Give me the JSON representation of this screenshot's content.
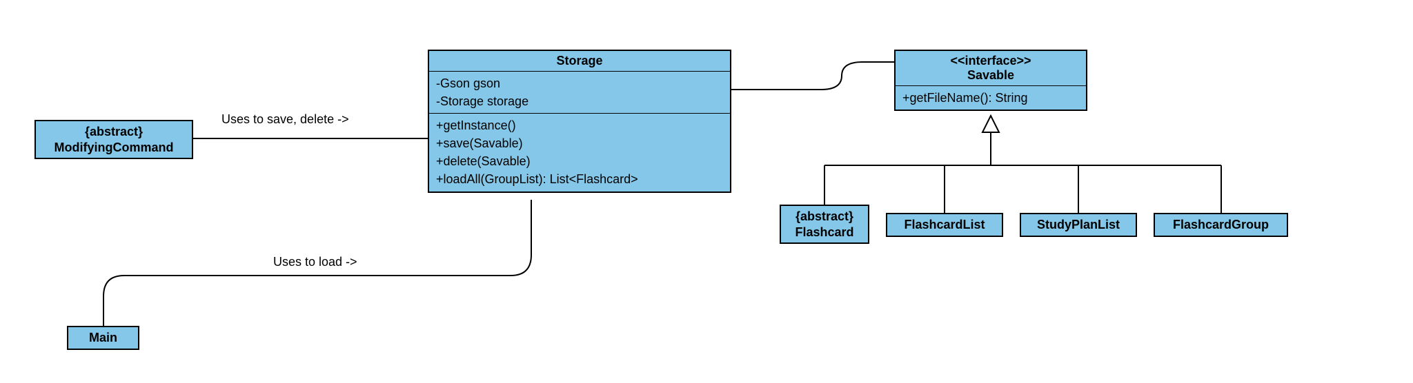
{
  "modifyingCommand": {
    "stereotype": "{abstract}",
    "name": "ModifyingCommand"
  },
  "main": {
    "name": "Main"
  },
  "storage": {
    "name": "Storage",
    "attrs": [
      "-Gson gson",
      "-Storage storage"
    ],
    "ops": [
      "+getInstance()",
      "+save(Savable)",
      "+delete(Savable)",
      "+loadAll(GroupList): List<Flashcard>"
    ]
  },
  "savable": {
    "stereotype": "<<interface>>",
    "name": "Savable",
    "ops": [
      "+getFileName(): String"
    ]
  },
  "flashcard": {
    "stereotype": "{abstract}",
    "name": "Flashcard"
  },
  "flashcardList": {
    "name": "FlashcardList"
  },
  "studyPlanList": {
    "name": "StudyPlanList"
  },
  "flashcardGroup": {
    "name": "FlashcardGroup"
  },
  "labels": {
    "usesSave": "Uses to save, delete ->",
    "usesLoad": "Uses to load ->"
  }
}
